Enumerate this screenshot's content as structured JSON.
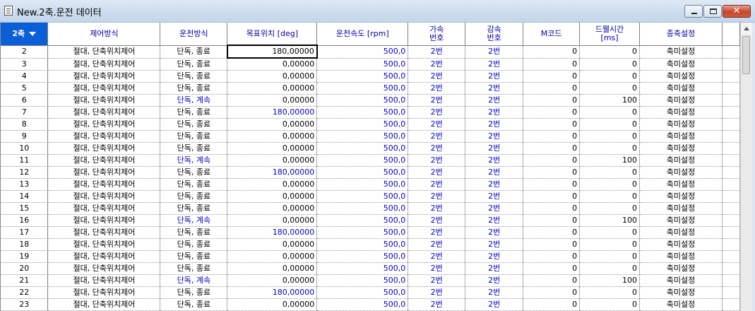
{
  "window": {
    "title": "New.2축.운전 데이터",
    "minimize_glyph": "minimize-icon",
    "maximize_glyph": "maximize-icon",
    "close_glyph": "✕"
  },
  "grid": {
    "corner_label": "2축",
    "headers": [
      "제어방식",
      "운전방식",
      "목표위치 [deg]",
      "운전속도 [rpm]",
      "가속\n번호",
      "감속\n번호",
      "M코드",
      "드웰시간\n[ms]",
      "종축설정"
    ],
    "rows": [
      {
        "no": "2",
        "control": "절대, 단축위치제어",
        "mode": "단독, 종료",
        "target": "180,00000",
        "speed": "500,0",
        "accel": "2번",
        "decel": "2번",
        "mcode": "0",
        "dwell": "0",
        "axis": "축미설정"
      },
      {
        "no": "3",
        "control": "절대, 단축위치제어",
        "mode": "단독, 종료",
        "target": "0,00000",
        "speed": "500,0",
        "accel": "2번",
        "decel": "2번",
        "mcode": "0",
        "dwell": "0",
        "axis": "축미설정"
      },
      {
        "no": "4",
        "control": "절대, 단축위치제어",
        "mode": "단독, 종료",
        "target": "0,00000",
        "speed": "500,0",
        "accel": "2번",
        "decel": "2번",
        "mcode": "0",
        "dwell": "0",
        "axis": "축미설정"
      },
      {
        "no": "5",
        "control": "절대, 단축위치제어",
        "mode": "단독, 종료",
        "target": "0,00000",
        "speed": "500,0",
        "accel": "2번",
        "decel": "2번",
        "mcode": "0",
        "dwell": "0",
        "axis": "축미설정"
      },
      {
        "no": "6",
        "control": "절대, 단축위치제어",
        "mode": "단독, 계속",
        "target": "0,00000",
        "speed": "500,0",
        "accel": "2번",
        "decel": "2번",
        "mcode": "0",
        "dwell": "100",
        "axis": "축미설정"
      },
      {
        "no": "7",
        "control": "절대, 단축위치제어",
        "mode": "단독, 종료",
        "target": "180,00000",
        "speed": "500,0",
        "accel": "2번",
        "decel": "2번",
        "mcode": "0",
        "dwell": "0",
        "axis": "축미설정"
      },
      {
        "no": "8",
        "control": "절대, 단축위치제어",
        "mode": "단독, 종료",
        "target": "0,00000",
        "speed": "500,0",
        "accel": "2번",
        "decel": "2번",
        "mcode": "0",
        "dwell": "0",
        "axis": "축미설정"
      },
      {
        "no": "9",
        "control": "절대, 단축위치제어",
        "mode": "단독, 종료",
        "target": "0,00000",
        "speed": "500,0",
        "accel": "2번",
        "decel": "2번",
        "mcode": "0",
        "dwell": "0",
        "axis": "축미설정"
      },
      {
        "no": "10",
        "control": "절대, 단축위치제어",
        "mode": "단독, 종료",
        "target": "0,00000",
        "speed": "500,0",
        "accel": "2번",
        "decel": "2번",
        "mcode": "0",
        "dwell": "0",
        "axis": "축미설정"
      },
      {
        "no": "11",
        "control": "절대, 단축위치제어",
        "mode": "단독, 계속",
        "target": "0,00000",
        "speed": "500,0",
        "accel": "2번",
        "decel": "2번",
        "mcode": "0",
        "dwell": "100",
        "axis": "축미설정"
      },
      {
        "no": "12",
        "control": "절대, 단축위치제어",
        "mode": "단독, 종료",
        "target": "180,00000",
        "speed": "500,0",
        "accel": "2번",
        "decel": "2번",
        "mcode": "0",
        "dwell": "0",
        "axis": "축미설정"
      },
      {
        "no": "13",
        "control": "절대, 단축위치제어",
        "mode": "단독, 종료",
        "target": "0,00000",
        "speed": "500,0",
        "accel": "2번",
        "decel": "2번",
        "mcode": "0",
        "dwell": "0",
        "axis": "축미설정"
      },
      {
        "no": "14",
        "control": "절대, 단축위치제어",
        "mode": "단독, 종료",
        "target": "0,00000",
        "speed": "500,0",
        "accel": "2번",
        "decel": "2번",
        "mcode": "0",
        "dwell": "0",
        "axis": "축미설정"
      },
      {
        "no": "15",
        "control": "절대, 단축위치제어",
        "mode": "단독, 종료",
        "target": "0,00000",
        "speed": "500,0",
        "accel": "2번",
        "decel": "2번",
        "mcode": "0",
        "dwell": "0",
        "axis": "축미설정"
      },
      {
        "no": "16",
        "control": "절대, 단축위치제어",
        "mode": "단독, 계속",
        "target": "0,00000",
        "speed": "500,0",
        "accel": "2번",
        "decel": "2번",
        "mcode": "0",
        "dwell": "100",
        "axis": "축미설정"
      },
      {
        "no": "17",
        "control": "절대, 단축위치제어",
        "mode": "단독, 종료",
        "target": "180,00000",
        "speed": "500,0",
        "accel": "2번",
        "decel": "2번",
        "mcode": "0",
        "dwell": "0",
        "axis": "축미설정"
      },
      {
        "no": "18",
        "control": "절대, 단축위치제어",
        "mode": "단독, 종료",
        "target": "0,00000",
        "speed": "500,0",
        "accel": "2번",
        "decel": "2번",
        "mcode": "0",
        "dwell": "0",
        "axis": "축미설정"
      },
      {
        "no": "19",
        "control": "절대, 단축위치제어",
        "mode": "단독, 종료",
        "target": "0,00000",
        "speed": "500,0",
        "accel": "2번",
        "decel": "2번",
        "mcode": "0",
        "dwell": "0",
        "axis": "축미설정"
      },
      {
        "no": "20",
        "control": "절대, 단축위치제어",
        "mode": "단독, 종료",
        "target": "0,00000",
        "speed": "500,0",
        "accel": "2번",
        "decel": "2번",
        "mcode": "0",
        "dwell": "0",
        "axis": "축미설정"
      },
      {
        "no": "21",
        "control": "절대, 단축위치제어",
        "mode": "단독, 계속",
        "target": "0,00000",
        "speed": "500,0",
        "accel": "2번",
        "decel": "2번",
        "mcode": "0",
        "dwell": "100",
        "axis": "축미설정"
      },
      {
        "no": "22",
        "control": "절대, 단축위치제어",
        "mode": "단독, 종료",
        "target": "180,00000",
        "speed": "500,0",
        "accel": "2번",
        "decel": "2번",
        "mcode": "0",
        "dwell": "0",
        "axis": "축미설정"
      },
      {
        "no": "23",
        "control": "절대, 단축위치제어",
        "mode": "단독, 종료",
        "target": "0,00000",
        "speed": "500,0",
        "accel": "2번",
        "decel": "2번",
        "mcode": "0",
        "dwell": "0",
        "axis": "축미설정"
      }
    ]
  }
}
